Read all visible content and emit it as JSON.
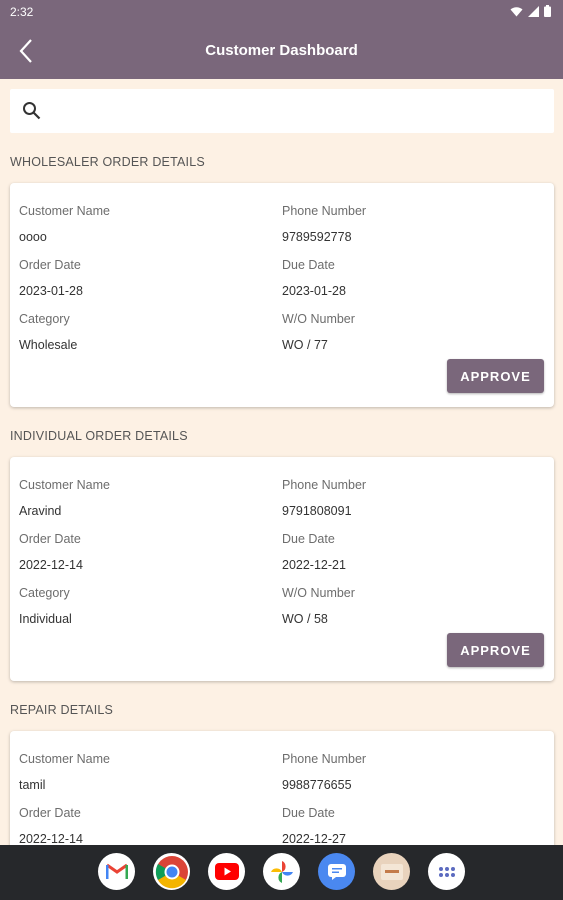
{
  "status_bar": {
    "time": "2:32"
  },
  "app_bar": {
    "title": "Customer Dashboard"
  },
  "search": {
    "placeholder": ""
  },
  "sections": [
    {
      "title": "WHOLESALER ORDER DETAILS",
      "customer_name_label": "Customer Name",
      "customer_name": "oooo",
      "phone_label": "Phone Number",
      "phone": "9789592778",
      "order_date_label": "Order Date",
      "order_date": "2023-01-28",
      "due_date_label": "Due Date",
      "due_date": "2023-01-28",
      "category_label": "Category",
      "category": "Wholesale",
      "wo_label": "W/O Number",
      "wo": "WO / 77",
      "button": "APPROVE"
    },
    {
      "title": "INDIVIDUAL ORDER DETAILS",
      "customer_name_label": "Customer Name",
      "customer_name": "Aravind",
      "phone_label": "Phone Number",
      "phone": "9791808091",
      "order_date_label": "Order Date",
      "order_date": "2022-12-14",
      "due_date_label": "Due Date",
      "due_date": "2022-12-21",
      "category_label": "Category",
      "category": "Individual",
      "wo_label": "W/O Number",
      "wo": "WO / 58",
      "button": "APPROVE"
    },
    {
      "title": "REPAIR DETAILS",
      "customer_name_label": "Customer Name",
      "customer_name": "tamil",
      "phone_label": "Phone Number",
      "phone": "9988776655",
      "order_date_label": "Order Date",
      "order_date": "2022-12-14",
      "due_date_label": "Due Date",
      "due_date": "2022-12-27"
    }
  ],
  "dock_apps": [
    "gmail-icon",
    "chrome-icon",
    "youtube-icon",
    "photos-icon",
    "messages-icon",
    "app-thumbnail-icon",
    "app-drawer-icon"
  ],
  "colors": {
    "primary": "#7A677B",
    "background": "#FDF1E4",
    "navbar": "#26282B"
  }
}
